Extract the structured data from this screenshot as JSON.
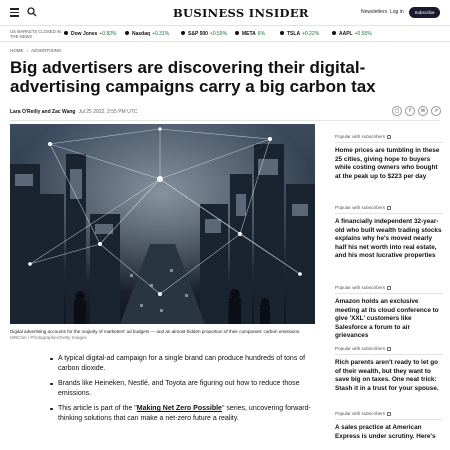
{
  "header": {
    "logo": "BUSINESS INSIDER",
    "newsletters": "Newsletters",
    "login": "Log in",
    "subscribe": "Subscribe"
  },
  "ticker": {
    "label": "US MARKETS CLOSED IN THE NEWS",
    "items": [
      {
        "name": "Dow Jones",
        "change": "+0.82%",
        "negative": false
      },
      {
        "name": "Nasdaq",
        "change": "+0.31%",
        "negative": false
      },
      {
        "name": "S&P 500",
        "change": "+0.59%",
        "negative": false
      },
      {
        "name": "META",
        "change": "6%",
        "negative": false
      },
      {
        "name": "TSLA",
        "change": "+0.22%",
        "negative": false
      },
      {
        "name": "AAPL",
        "change": "+0.55%",
        "negative": false
      }
    ]
  },
  "breadcrumb": {
    "home": "HOME",
    "section": "ADVERTISING"
  },
  "article": {
    "headline": "Big advertisers are discovering their digital-advertising campaigns carry a big carbon tax",
    "authors": "Lara O'Reilly and Zac Wang",
    "date": "Jul 25 2022, 2:55 PM UTC",
    "caption": "Digital advertising accounts for the majority of marketers' ad budgets — and an almost-hidden proportion of their companies' carbon emissions.",
    "credit": "MRChin / Photographer/Getty Images",
    "bullets": {
      "b1": "A typical digital-ad campaign for a single brand can produce hundreds of tons of carbon dioxide.",
      "b2": "Brands like Heineken, Nestlé, and Toyota are figuring out how to reduce those emissions.",
      "b3_pre": "This article is part of the \"",
      "b3_link": "Making Net Zero Possible",
      "b3_post": "\" series, uncovering forward-thinking solutions that can make a net-zero future a reality."
    }
  },
  "share": {
    "icons": [
      "bookmark-icon",
      "facebook-icon",
      "email-icon",
      "share-icon"
    ],
    "glyphs": [
      "▢",
      "f",
      "✉",
      "↗"
    ]
  },
  "sidebar": {
    "items": [
      {
        "label": "Popular with subscribers",
        "title": "Home prices are tumbling in these 25 cities, giving hope to buyers while costing owners who bought at the peak up to $223 per day"
      },
      {
        "label": "Popular with subscribers",
        "title": "A financially independent 32-year-old who built wealth trading stocks explains why he's moved nearly half his net worth into real estate, and his most lucrative properties"
      },
      {
        "label": "Popular with subscribers",
        "title": "Amazon holds an exclusive meeting at its cloud conference to give 'XXL' customers like Salesforce a forum to air grievances"
      },
      {
        "label": "Popular with subscribers",
        "title": "Rich parents aren't ready to let go of their wealth, but they want to save big on taxes. One neat trick: Stash it in a trust for your spouse."
      },
      {
        "label": "Popular with subscribers",
        "title": "A sales practice at American Express is under scrutiny. Here's"
      }
    ]
  },
  "colors": {
    "subscribe_bg": "#1a1a2e",
    "positive": "#0a7a32",
    "negative": "#c62828"
  }
}
